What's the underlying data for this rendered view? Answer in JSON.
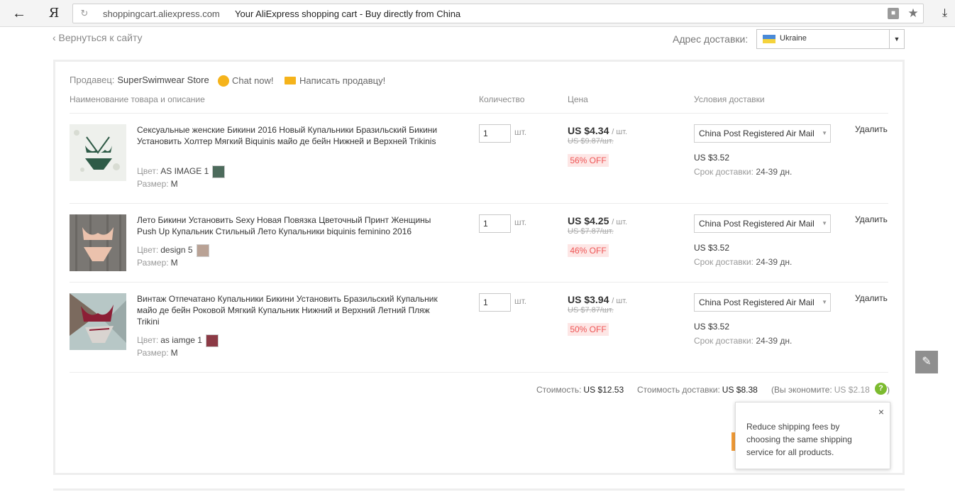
{
  "browser": {
    "back_icon": "arrow-left-icon",
    "logo": "Я",
    "url_domain": "shoppingcart.aliexpress.com",
    "page_title": "Your AliExpress shopping cart - Buy directly from China"
  },
  "header": {
    "back_link": "‹ Вернуться к сайту",
    "ship_label": "Адрес доставки:",
    "country": "Ukraine"
  },
  "cart": {
    "seller_label": "Продавец:",
    "seller_name": "SuperSwimwear Store",
    "chat_label": "Chat now!",
    "message_label": "Написать продавцу!",
    "columns": {
      "product": "Наименование товара и описание",
      "quantity": "Количество",
      "price": "Цена",
      "shipping": "Условия доставки"
    },
    "items": [
      {
        "title": "Сексуальные женские Бикини 2016 Новый Купальники Бразильский Бикини Установить Холтер Мягкий Biquinis майо де бейн Нижней и Верхней Trikinis",
        "color_label": "Цвет:",
        "color": "AS IMAGE 1",
        "size_label": "Размер:",
        "size": "M",
        "qty": "1",
        "unit": "шт.",
        "price": "US $4.34",
        "per": "/ шт.",
        "old_price": "US $9.87/шт.",
        "discount": "56% OFF",
        "shipping": "China Post Registered Air Mail",
        "ship_cost": "US $3.52",
        "eta_label": "Срок доставки:",
        "eta": "24-39 дн.",
        "delete": "Удалить"
      },
      {
        "title": "Лето Бикини Установить Sexy Новая Повязка Цветочный Принт Женщины Push Up Купальник Стильный Лето Купальники biquinis feminino 2016",
        "color_label": "Цвет:",
        "color": "design 5",
        "size_label": "Размер:",
        "size": "M",
        "qty": "1",
        "unit": "шт.",
        "price": "US $4.25",
        "per": "/ шт.",
        "old_price": "US $7.87/шт.",
        "discount": "46% OFF",
        "shipping": "China Post Registered Air Mail",
        "ship_cost": "US $3.52",
        "eta_label": "Срок доставки:",
        "eta": "24-39 дн.",
        "delete": "Удалить"
      },
      {
        "title": "Винтаж Отпечатано Купальники Бикини Установить Бразильский Купальник майо де бейн Роковой Мягкий Купальник Нижний и Верхний Летний Пляж Trikini",
        "color_label": "Цвет:",
        "color": "as iamge 1",
        "size_label": "Размер:",
        "size": "M",
        "qty": "1",
        "unit": "шт.",
        "price": "US $3.94",
        "per": "/ шт.",
        "old_price": "US $7.87/шт.",
        "discount": "50% OFF",
        "shipping": "China Post Registered Air Mail",
        "ship_cost": "US $3.52",
        "eta_label": "Срок доставки:",
        "eta": "24-39 дн.",
        "delete": "Удалить"
      }
    ],
    "summary": {
      "cost_label": "Стоимость:",
      "cost": "US $12.53",
      "ship_label": "Стоимость доставки:",
      "ship": "US $8.38",
      "save_label": "(Вы экономите:",
      "save": "US $2.18",
      "help": "?",
      "close_paren": ")"
    },
    "tooltip": {
      "close": "×",
      "text": "Reduce shipping fees by choosing the same shipping service for all products."
    }
  },
  "colors": {
    "discount_bg": "#fde6e5",
    "discount_text": "#e55555",
    "help_green": "#7cbb2f",
    "accent_orange": "#f29c38"
  }
}
